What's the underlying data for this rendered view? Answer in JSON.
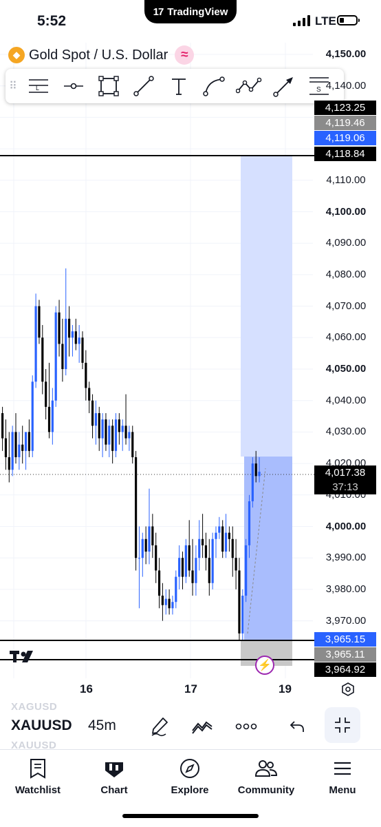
{
  "status_bar": {
    "time": "5:52",
    "app_name": "TradingView",
    "network": "LTE"
  },
  "symbol": {
    "title": "Gold Spot / U.S. Dollar",
    "icon": "gold-coin-icon",
    "badge_icon": "wave-icon"
  },
  "drawing_tools": [
    "horizontal-ray-icon",
    "horizontal-line-icon",
    "rectangle-icon",
    "trend-line-icon",
    "text-icon",
    "curve-icon",
    "path-icon",
    "arrow-icon",
    "short-position-icon"
  ],
  "tool_glyphs": {
    "ray": "L",
    "short": "S"
  },
  "price_axis": {
    "labels": [
      "4,150.00",
      "4,140.00",
      "4,110.00",
      "4,100.00",
      "4,090.00",
      "4,080.00",
      "4,070.00",
      "4,060.00",
      "4,050.00",
      "4,040.00",
      "4,030.00",
      "4,020.00",
      "4,010.00",
      "4,000.00",
      "3,990.00",
      "3,980.00",
      "3,970.00"
    ],
    "bold_labels": [
      "4,150.00",
      "4,100.00",
      "4,050.00",
      "4,000.00"
    ]
  },
  "tags": {
    "t1": "4,123.25",
    "t2": "4,119.46",
    "t3": "4,119.06",
    "t4": "4,118.84",
    "live_price": "4,017.38",
    "countdown": "37:13",
    "b1": "3,965.15",
    "b2": "3,965.11",
    "b3": "3,964.92"
  },
  "colors": {
    "up": "#2962ff",
    "down": "#000000",
    "zone": "#d6e0ff",
    "zone_dark": "#a9bdfd",
    "stop": "#c8c8c8"
  },
  "dates": [
    "16",
    "17",
    "19"
  ],
  "bottom_bar": {
    "symbol": "XAUUSD",
    "ghost_symbol_top": "XAGUSD",
    "ghost_symbol_bottom": "XAUUSD",
    "interval": "45m"
  },
  "tabs": [
    {
      "label": "Watchlist",
      "icon": "watchlist-icon"
    },
    {
      "label": "Chart",
      "icon": "chart-icon"
    },
    {
      "label": "Explore",
      "icon": "compass-icon"
    },
    {
      "label": "Community",
      "icon": "community-icon"
    },
    {
      "label": "Menu",
      "icon": "menu-icon"
    }
  ],
  "chart_data": {
    "type": "candlestick",
    "ylim": [
      3958,
      4155
    ],
    "candles": [
      [
        4036,
        4038,
        4024,
        4028
      ],
      [
        4028,
        4034,
        4018,
        4022
      ],
      [
        4022,
        4030,
        4014,
        4018
      ],
      [
        4018,
        4032,
        4016,
        4030
      ],
      [
        4030,
        4036,
        4020,
        4022
      ],
      [
        4022,
        4030,
        4018,
        4026
      ],
      [
        4026,
        4032,
        4020,
        4024
      ],
      [
        4024,
        4028,
        4018,
        4030
      ],
      [
        4030,
        4034,
        4022,
        4024
      ],
      [
        4024,
        4048,
        4022,
        4046
      ],
      [
        4046,
        4074,
        4044,
        4070
      ],
      [
        4070,
        4072,
        4058,
        4060
      ],
      [
        4060,
        4064,
        4042,
        4046
      ],
      [
        4046,
        4050,
        4034,
        4038
      ],
      [
        4038,
        4052,
        4028,
        4030
      ],
      [
        4030,
        4044,
        4026,
        4040
      ],
      [
        4040,
        4070,
        4038,
        4068
      ],
      [
        4068,
        4072,
        4054,
        4058
      ],
      [
        4058,
        4066,
        4046,
        4050
      ],
      [
        4050,
        4082,
        4048,
        4066
      ],
      [
        4066,
        4070,
        4054,
        4060
      ],
      [
        4060,
        4064,
        4054,
        4062
      ],
      [
        4062,
        4066,
        4056,
        4058
      ],
      [
        4058,
        4064,
        4052,
        4060
      ],
      [
        4060,
        4062,
        4050,
        4052
      ],
      [
        4052,
        4056,
        4040,
        4044
      ],
      [
        4044,
        4046,
        4036,
        4040
      ],
      [
        4040,
        4042,
        4028,
        4032
      ],
      [
        4032,
        4040,
        4026,
        4036
      ],
      [
        4036,
        4038,
        4024,
        4028
      ],
      [
        4028,
        4036,
        4022,
        4034
      ],
      [
        4034,
        4036,
        4024,
        4026
      ],
      [
        4026,
        4034,
        4022,
        4032
      ],
      [
        4032,
        4034,
        4020,
        4024
      ],
      [
        4024,
        4036,
        4022,
        4034
      ],
      [
        4034,
        4036,
        4026,
        4030
      ],
      [
        4030,
        4034,
        4024,
        4032
      ],
      [
        4032,
        4042,
        4026,
        4028
      ],
      [
        4028,
        4032,
        4024,
        4030
      ],
      [
        4030,
        4032,
        4020,
        4022
      ],
      [
        4022,
        4024,
        3986,
        3990
      ],
      [
        3990,
        4000,
        3974,
        3990
      ],
      [
        3990,
        3998,
        3984,
        3996
      ],
      [
        3996,
        4000,
        3988,
        3992
      ],
      [
        3992,
        4012,
        3988,
        4000
      ],
      [
        4000,
        4004,
        3990,
        3994
      ],
      [
        3994,
        3998,
        3982,
        3986
      ],
      [
        3986,
        3990,
        3974,
        3978
      ],
      [
        3978,
        3982,
        3970,
        3975
      ],
      [
        3975,
        3980,
        3972,
        3977
      ],
      [
        3977,
        3980,
        3972,
        3974
      ],
      [
        3974,
        3978,
        3972,
        3976
      ],
      [
        3976,
        3986,
        3974,
        3984
      ],
      [
        3984,
        3994,
        3980,
        3990
      ],
      [
        3990,
        3992,
        3980,
        3984
      ],
      [
        3984,
        3996,
        3982,
        3994
      ],
      [
        3994,
        4002,
        3984,
        3986
      ],
      [
        3986,
        3996,
        3978,
        3982
      ],
      [
        3982,
        3994,
        3978,
        3990
      ],
      [
        3990,
        4002,
        3986,
        3996
      ],
      [
        3996,
        4004,
        3990,
        3994
      ],
      [
        3994,
        3998,
        3986,
        3990
      ],
      [
        3990,
        3996,
        3978,
        3982
      ],
      [
        3982,
        3998,
        3980,
        3996
      ],
      [
        3996,
        4000,
        3990,
        3998
      ],
      [
        3998,
        4003,
        3996,
        4000
      ],
      [
        4000,
        4002,
        3990,
        3992
      ],
      [
        3992,
        4004,
        3990,
        3998
      ],
      [
        3998,
        4000,
        3992,
        3996
      ],
      [
        3996,
        4000,
        3984,
        3990
      ],
      [
        3990,
        3996,
        3980,
        3986
      ],
      [
        3986,
        3990,
        3964,
        3966
      ],
      [
        3966,
        3980,
        3964,
        3978
      ],
      [
        3978,
        3996,
        3976,
        3994
      ],
      [
        3994,
        4010,
        3990,
        4008
      ],
      [
        4008,
        4022,
        4006,
        4020
      ],
      [
        4020,
        4024,
        4014,
        4016
      ],
      [
        4016,
        4022,
        4014,
        4017.38
      ]
    ]
  }
}
